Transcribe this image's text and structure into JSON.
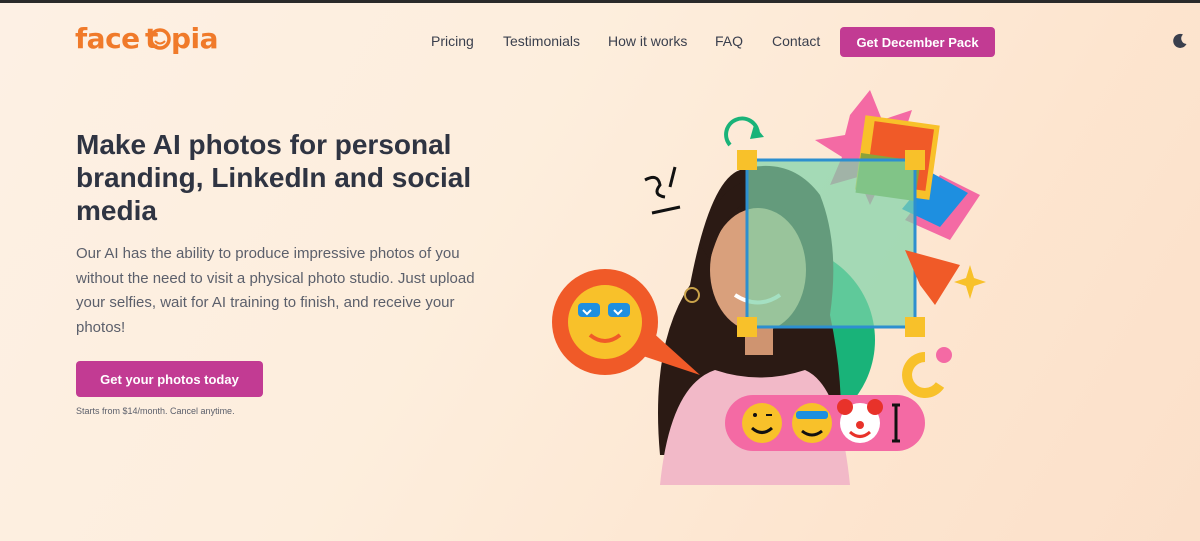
{
  "brand": {
    "name": "facetopia",
    "color": "#f07a2a"
  },
  "nav": {
    "items": [
      {
        "label": "Pricing"
      },
      {
        "label": "Testimonials"
      },
      {
        "label": "How it works"
      },
      {
        "label": "FAQ"
      },
      {
        "label": "Contact"
      }
    ],
    "cta_label": "Get December Pack",
    "theme_toggle_icon": "moon-icon"
  },
  "hero": {
    "headline": "Make AI photos for personal branding, LinkedIn and social media",
    "description": "Our AI has the ability to produce impressive photos of you without the need to visit a physical photo studio. Just upload your selfies, wait for AI training to finish, and receive your photos!",
    "cta_label": "Get your photos today",
    "note": "Starts from $14/month. Cancel anytime."
  },
  "colors": {
    "accent": "#c23b93",
    "brand_orange": "#f07a2a",
    "text_dark": "#2f3442"
  }
}
